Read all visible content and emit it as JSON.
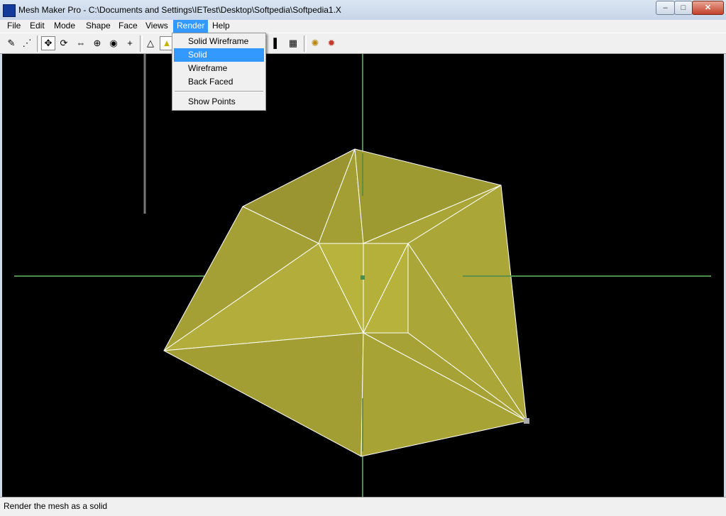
{
  "window": {
    "app_name": "Mesh Maker Pro",
    "title_separator": "-",
    "file_path": "C:\\Documents and Settings\\IETest\\Desktop\\Softpedia\\Softpedia1.X",
    "controls": {
      "minimize": "–",
      "maximize": "□",
      "close": "✕"
    }
  },
  "menu": {
    "items": [
      {
        "label": "File"
      },
      {
        "label": "Edit"
      },
      {
        "label": "Mode"
      },
      {
        "label": "Shape"
      },
      {
        "label": "Face"
      },
      {
        "label": "Views"
      },
      {
        "label": "Render",
        "open": true
      },
      {
        "label": "Help"
      }
    ]
  },
  "toolbar": {
    "buttons": [
      {
        "icon": "pencil-icon",
        "glyph": "✎"
      },
      {
        "icon": "select-points-icon",
        "glyph": "⋰"
      },
      {
        "icon": "move-icon",
        "glyph": "✥",
        "pressed": true
      },
      {
        "icon": "rotate-icon",
        "glyph": "⟳"
      },
      {
        "icon": "scale-icon",
        "glyph": "⇔"
      },
      {
        "icon": "stretch-icon",
        "glyph": "⊕"
      },
      {
        "icon": "orbit-icon",
        "glyph": "◉"
      },
      {
        "icon": "crosshair-icon",
        "glyph": "+"
      },
      {
        "icon": "draw-triangle-icon",
        "glyph": "△"
      },
      {
        "icon": "paint-icon",
        "glyph": "▲"
      },
      {
        "icon": "single-view-icon",
        "glyph": "▌"
      },
      {
        "icon": "quad-view-icon",
        "glyph": "▦"
      },
      {
        "icon": "light-icon",
        "glyph": "✺"
      },
      {
        "icon": "color-icon",
        "glyph": "✹"
      }
    ]
  },
  "render_menu": {
    "items": [
      {
        "label": "Solid Wireframe"
      },
      {
        "label": "Solid",
        "highlighted": true
      },
      {
        "label": "Wireframe"
      },
      {
        "label": "Back Faced"
      },
      {
        "label": "Show Points"
      }
    ]
  },
  "viewport": {
    "background_color": "#000000",
    "axis_color": "#4c8c4c",
    "mesh_color": "#a8a42e",
    "edge_color": "#ffffff"
  },
  "status": {
    "text": "Render the mesh as a solid"
  }
}
